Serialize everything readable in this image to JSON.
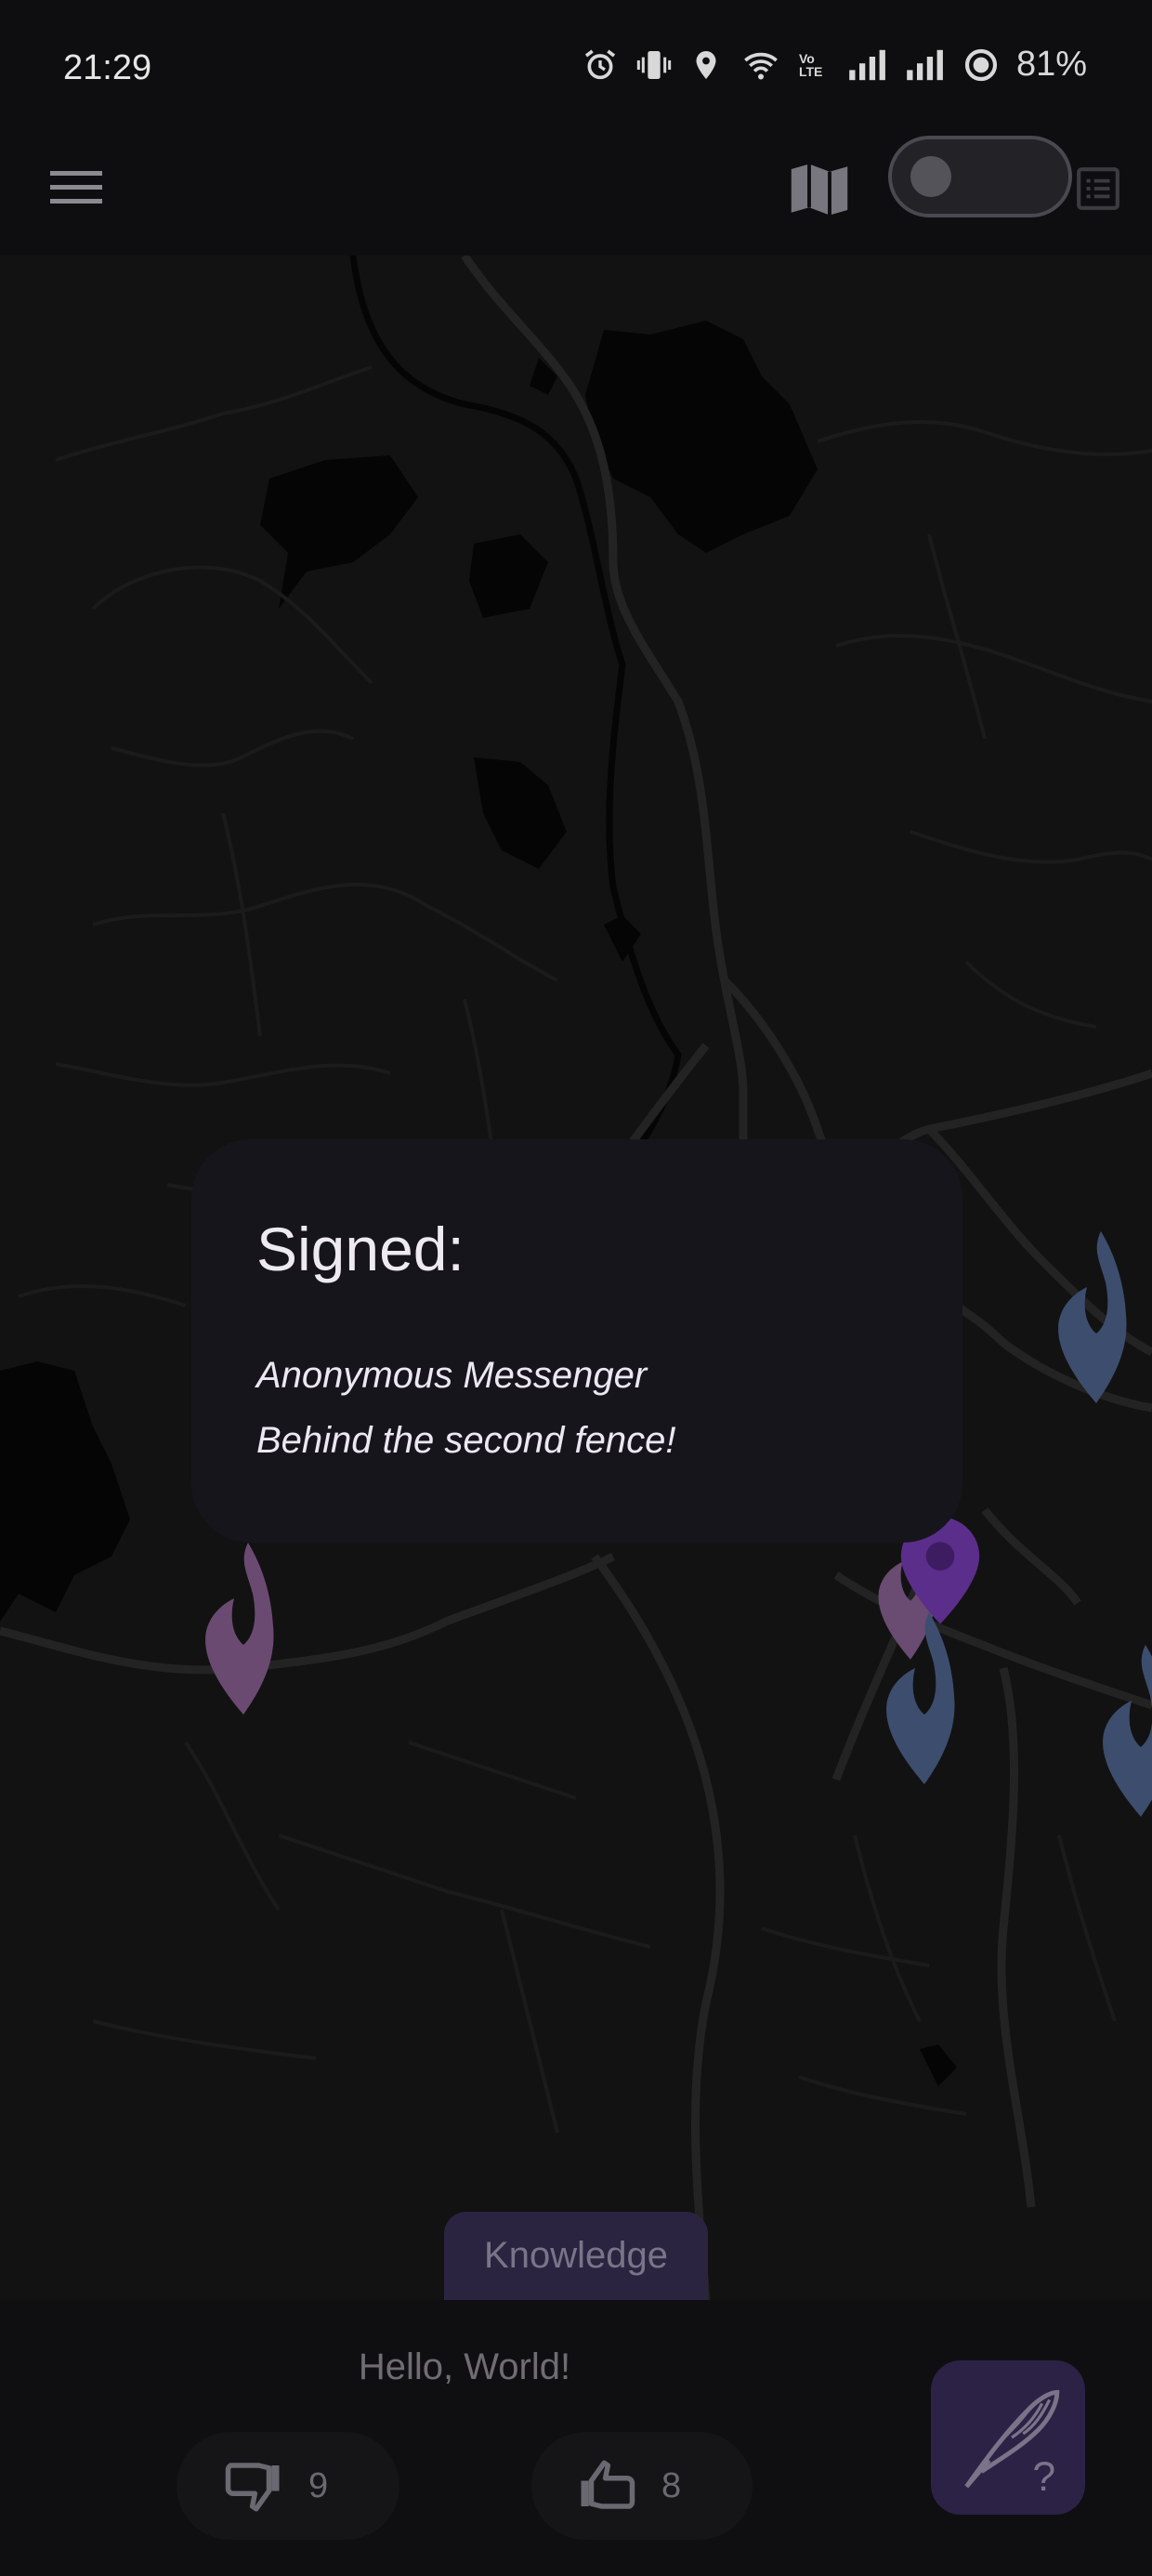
{
  "status_bar": {
    "time": "21:29",
    "battery": "81%",
    "network_badge": "Vo LTE"
  },
  "app_bar": {
    "menu_icon": "hamburger-menu-icon",
    "map_icon": "map-icon",
    "toggle_state": "off",
    "list_icon": "list-icon"
  },
  "card": {
    "title": "Signed:",
    "line1": "Anonymous Messenger",
    "line2": "Behind the second fence!"
  },
  "map": {
    "markers": [
      {
        "color": "#6b4a72",
        "icon": "flame-marker-icon"
      },
      {
        "color": "#3d4d6e",
        "icon": "flame-marker-icon"
      },
      {
        "color": "#6a4b72",
        "icon": "flame-marker-icon"
      },
      {
        "color": "#5a2e8a",
        "icon": "location-pin-icon"
      },
      {
        "color": "#3d4d6e",
        "icon": "flame-marker-icon"
      },
      {
        "color": "#3d4d6e",
        "icon": "flame-marker-icon"
      }
    ]
  },
  "tab": {
    "label": "Knowledge"
  },
  "bottom": {
    "message": "Hello, World!",
    "dislikes": "9",
    "likes": "8",
    "fab_icon": "quill-question-icon"
  },
  "colors": {
    "background": "#0d0d0d",
    "card": "#17151c",
    "accent": "#2c2246",
    "tab": "#2a2440"
  }
}
